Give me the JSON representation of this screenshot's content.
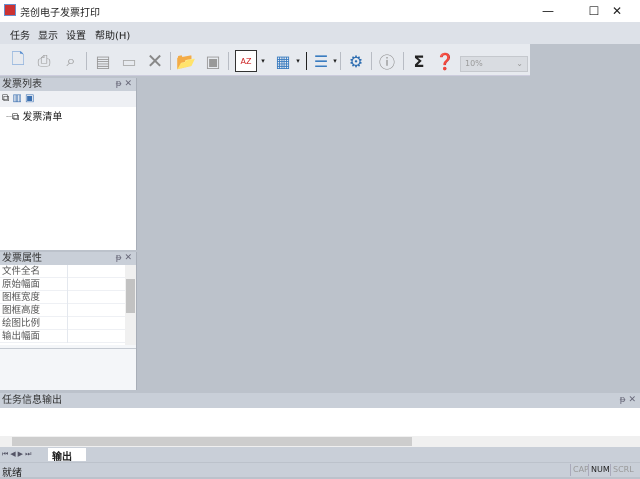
{
  "window": {
    "title": "尧创电子发票打印",
    "minimize": "—",
    "maximize": "☐",
    "close": "✕"
  },
  "menu": [
    "任务",
    "显示",
    "设置",
    "帮助(H)"
  ],
  "toolbar": {
    "zoom_value": "10%"
  },
  "invoice_list": {
    "title": "发票列表",
    "pin": "ᵽ",
    "close": "✕",
    "tree_root": "发票清单"
  },
  "properties": {
    "title": "发票属性",
    "pin": "ᵽ",
    "close": "✕",
    "rows": [
      "文件全名",
      "原始幅面",
      "图框宽度",
      "图框高度",
      "绘图比例",
      "输出幅面"
    ]
  },
  "output_panel": {
    "title": "任务信息输出",
    "pin": "ᵽ",
    "close": "✕",
    "tab": "输出"
  },
  "status": {
    "text": "就绪",
    "indicators": [
      "CAP",
      "NUM",
      "SCRL"
    ]
  }
}
